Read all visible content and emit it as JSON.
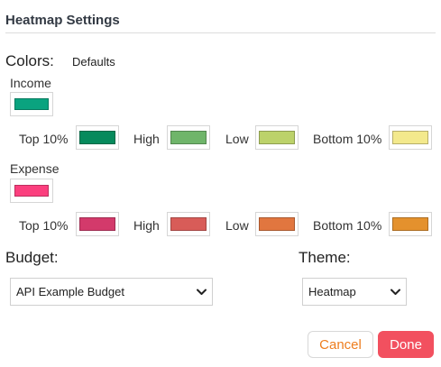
{
  "dialog": {
    "title": "Heatmap Settings"
  },
  "colors": {
    "label": "Colors:",
    "defaults_link": "Defaults",
    "income": {
      "label": "Income",
      "color": "#0aa37f",
      "tiers": [
        {
          "label": "Top 10%",
          "color": "#068a5c"
        },
        {
          "label": "High",
          "color": "#6fb56a"
        },
        {
          "label": "Low",
          "color": "#bcd26a"
        },
        {
          "label": "Bottom 10%",
          "color": "#f3e98c"
        }
      ]
    },
    "expense": {
      "label": "Expense",
      "color": "#fb3f7e",
      "tiers": [
        {
          "label": "Top 10%",
          "color": "#d33a6b"
        },
        {
          "label": "High",
          "color": "#d85c58"
        },
        {
          "label": "Low",
          "color": "#e1763f"
        },
        {
          "label": "Bottom 10%",
          "color": "#e4912d"
        }
      ]
    }
  },
  "budget": {
    "label": "Budget:",
    "selected": "API Example Budget"
  },
  "theme": {
    "label": "Theme:",
    "selected": "Heatmap"
  },
  "actions": {
    "cancel_label": "Cancel",
    "done_label": "Done"
  }
}
